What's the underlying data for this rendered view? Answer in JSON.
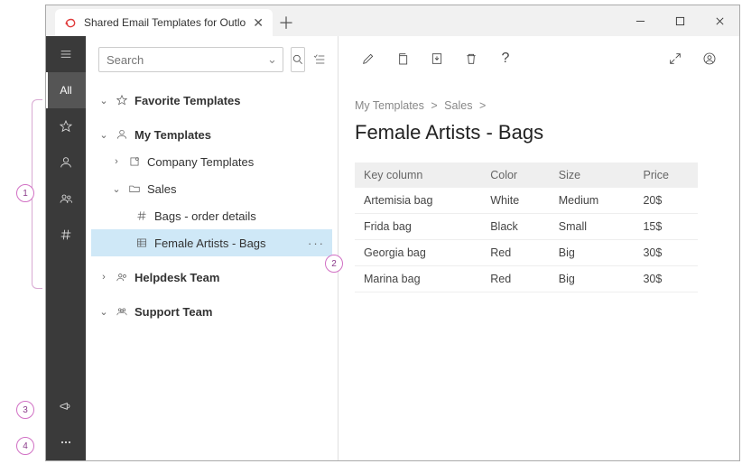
{
  "window": {
    "tab_title": "Shared Email Templates for Outlo"
  },
  "callouts": {
    "c1": "1",
    "c2": "2",
    "c3": "3",
    "c4": "4"
  },
  "rail": {
    "all": "All"
  },
  "search": {
    "placeholder": "Search"
  },
  "tree": {
    "favorites": "Favorite Templates",
    "mytemplates": "My Templates",
    "company": "Company Templates",
    "sales": "Sales",
    "bags_order": "Bags - order details",
    "female_artists": "Female Artists - Bags",
    "helpdesk": "Helpdesk Team",
    "support": "Support Team",
    "dots": "···"
  },
  "breadcrumb": {
    "a": "My Templates",
    "b": "Sales",
    "sep": ">"
  },
  "page_title": "Female Artists - Bags",
  "table": {
    "headers": {
      "key": "Key column",
      "color": "Color",
      "size": "Size",
      "price": "Price"
    },
    "rows": [
      {
        "key": "Artemisia bag",
        "color": "White",
        "size": "Medium",
        "price": "20$"
      },
      {
        "key": "Frida bag",
        "color": "Black",
        "size": "Small",
        "price": "15$"
      },
      {
        "key": "Georgia bag",
        "color": "Red",
        "size": "Big",
        "price": "30$"
      },
      {
        "key": "Marina bag",
        "color": "Red",
        "size": "Big",
        "price": "30$"
      }
    ]
  },
  "toolbar": {
    "q": "?"
  }
}
